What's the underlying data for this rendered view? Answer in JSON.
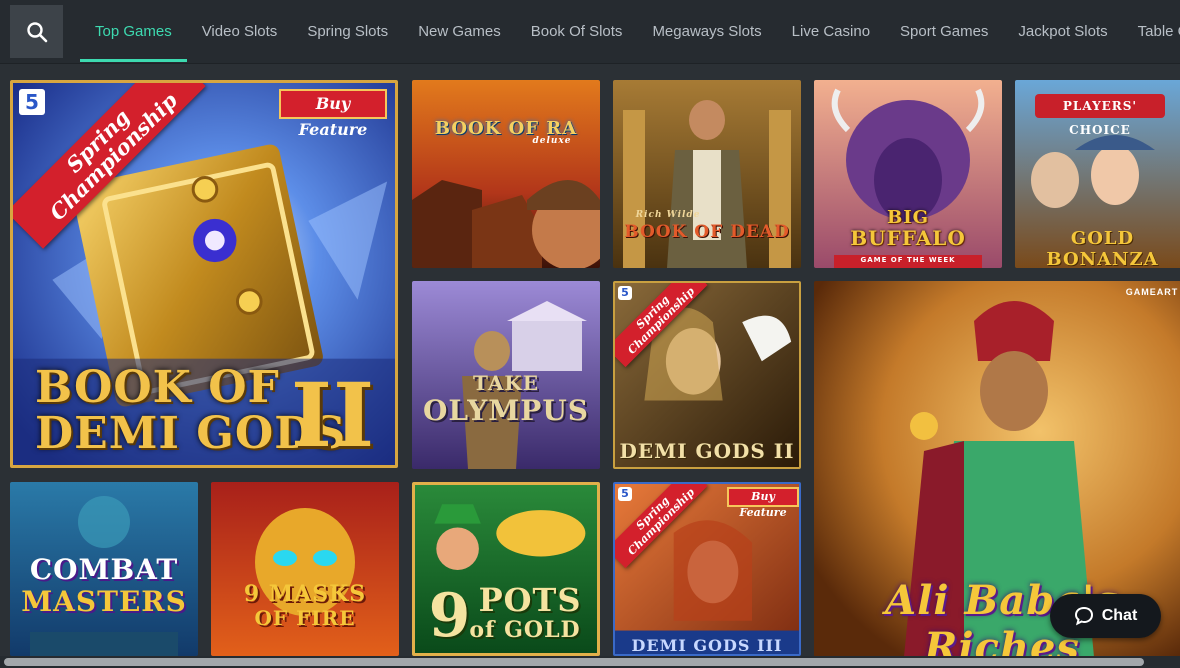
{
  "nav": {
    "tabs": [
      {
        "label": "Top Games",
        "active": true
      },
      {
        "label": "Video Slots"
      },
      {
        "label": "Spring Slots"
      },
      {
        "label": "New Games"
      },
      {
        "label": "Book Of Slots"
      },
      {
        "label": "Megaways Slots"
      },
      {
        "label": "Live Casino"
      },
      {
        "label": "Sport Games"
      },
      {
        "label": "Jackpot Slots"
      },
      {
        "label": "Table Game"
      }
    ]
  },
  "games": {
    "demigods2book": {
      "title1": "BOOK OF",
      "title2": "DEMI GODS",
      "numeral": "II",
      "ribbon": "Spring\nChampionship",
      "badge": "5",
      "buy": "Buy Feature"
    },
    "bookofra": {
      "title": "BOOK OF RA",
      "sub": "deluxe"
    },
    "bookofdead": {
      "small": "Rich Wilde",
      "title": "BOOK OF DEAD"
    },
    "bigbuffalo": {
      "title1": "BIG",
      "title2": "BUFFALO",
      "sub": "GAME OF THE WEEK"
    },
    "goldbonanza": {
      "top": "PLAYERS' CHOICE",
      "title": "GOLD BONANZA"
    },
    "olympus": {
      "title1": "TAKE",
      "title2": "OLYMPUS"
    },
    "demigods2": {
      "title": "DEMI GODS II",
      "ribbon": "Spring\nChampionship",
      "badge": "5"
    },
    "alibaba": {
      "title": "Ali Baba's Riches",
      "corner": "GAMEART"
    },
    "combat": {
      "title1": "COMBAT",
      "title2": "MASTERS"
    },
    "masks": {
      "title1": "9 MASKS",
      "title2": "OF FIRE"
    },
    "pots": {
      "title1": "9",
      "title2": "POTS",
      "title3": "of GOLD"
    },
    "demigods3": {
      "title": "DEMI GODS III",
      "ribbon": "Spring\nChampionship",
      "badge": "5",
      "buy": "Buy Feature"
    }
  },
  "chat": {
    "label": "Chat"
  },
  "colors": {
    "accent": "#3ddab0",
    "background": "#2b3035",
    "navbar": "#262b30"
  }
}
